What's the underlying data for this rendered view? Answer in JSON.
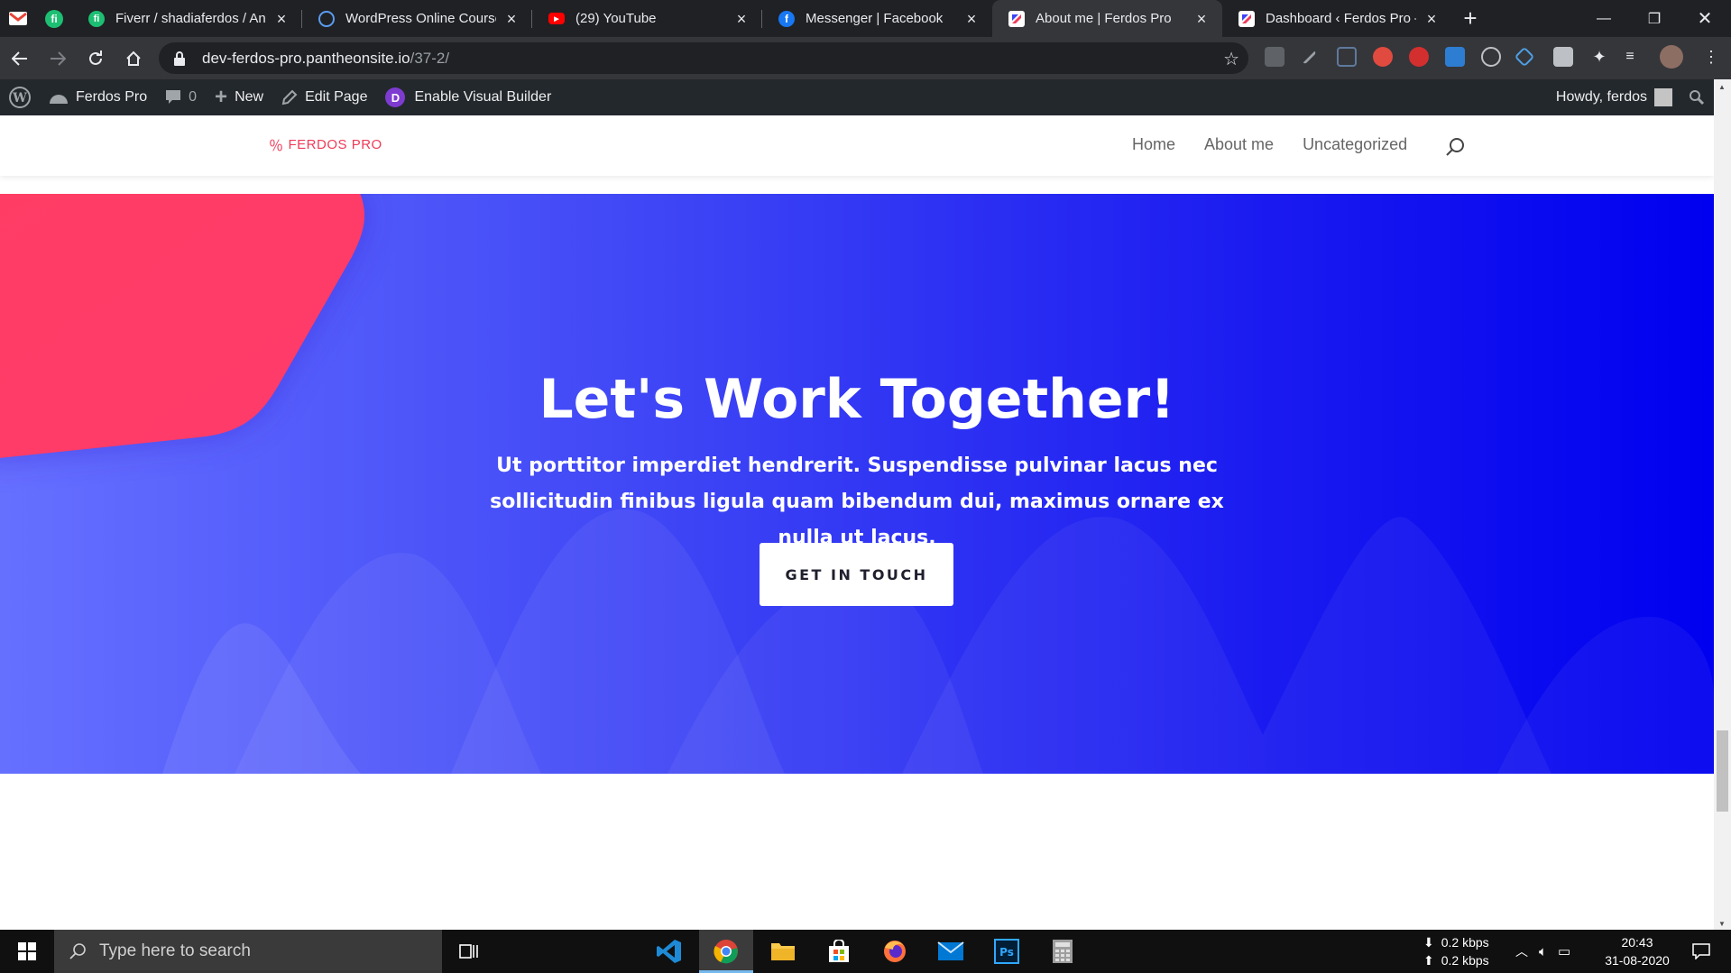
{
  "browser": {
    "tabs": [
      {
        "title": "Fiverr / shadiaferdos / Ana",
        "favicon": "fiverr-icon",
        "color": "#1dbf73"
      },
      {
        "title": "WordPress Online Course",
        "favicon": "course-icon",
        "color": "#1a73e8"
      },
      {
        "title": "(29) YouTube",
        "favicon": "youtube-icon",
        "color": "#ff0000"
      },
      {
        "title": "Messenger | Facebook",
        "favicon": "facebook-icon",
        "color": "#1877f2"
      },
      {
        "title": "About me | Ferdos Pro",
        "favicon": "site-icon",
        "color": "#ffffff"
      },
      {
        "title": "Dashboard ‹ Ferdos Pro —",
        "favicon": "site-icon",
        "color": "#ffffff"
      }
    ],
    "active_tab_index": 4,
    "url_host": "dev-ferdos-pro.pantheonsite.io",
    "url_path": "/37-2/"
  },
  "wp_admin_bar": {
    "site_name": "Ferdos Pro",
    "comments_count": "0",
    "new_label": "New",
    "edit_label": "Edit Page",
    "builder_label": "Enable Visual Builder",
    "howdy": "Howdy, ferdos"
  },
  "site": {
    "logo_text": "FERDOS PRO",
    "nav": [
      "Home",
      "About me",
      "Uncategorized"
    ]
  },
  "hero": {
    "heading": "Let's Work Together!",
    "body": "Ut porttitor imperdiet hendrerit. Suspendisse pulvinar lacus nec sollicitudin finibus ligula quam bibendum dui, maximus ornare ex nulla ut lacus.",
    "cta_label": "GET IN TOUCH",
    "gradient_start": "#6670ff",
    "gradient_end": "#0000f0",
    "accent_shape_color": "#ff3d64"
  },
  "taskbar": {
    "search_placeholder": "Type here to search",
    "net_down": "0.2 kbps",
    "net_up": "0.2 kbps",
    "time": "20:43",
    "date": "31-08-2020"
  }
}
